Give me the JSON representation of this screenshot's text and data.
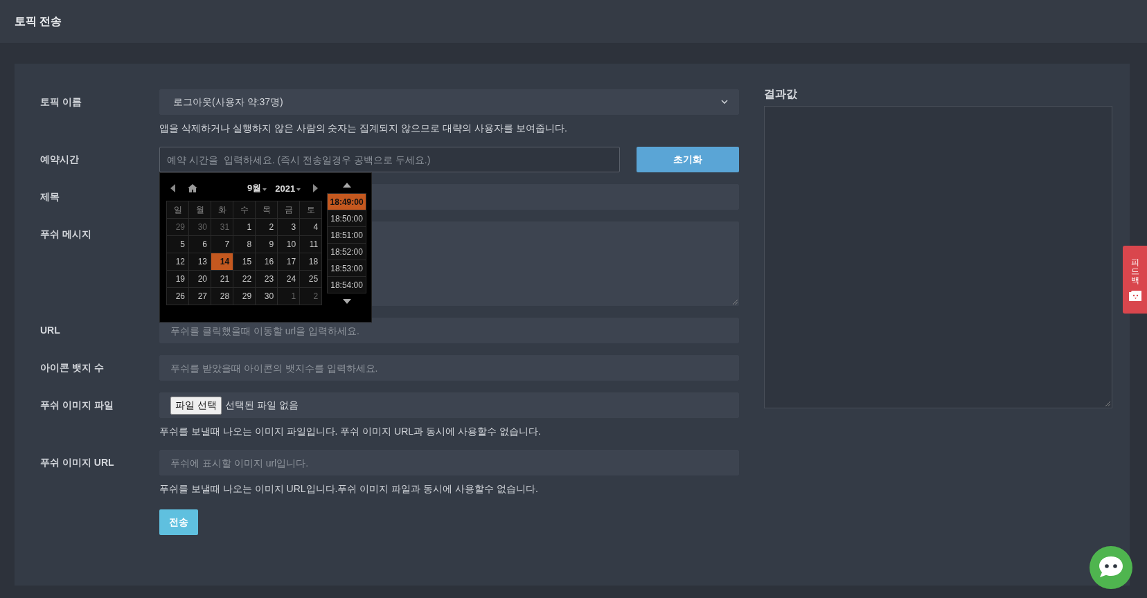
{
  "page_title": "토픽 전송",
  "fields": [
    {
      "kind": "select",
      "label": "토픽 이름",
      "value": "로그아웃(사용자 약:37명)",
      "help": "앱을 삭제하거나 실행하지 않은 사람의 숫자는 집계되지 않으므로 대략의 사용자를 보여줍니다."
    },
    {
      "kind": "datetime",
      "label": "예약시간",
      "placeholder": "예약 시간을  입력하세요. (즉시 전송일경우 공백으로 두세요.)",
      "button": "초기화"
    },
    {
      "kind": "text",
      "label": "제목"
    },
    {
      "kind": "textarea",
      "label": "푸쉬 메시지"
    },
    {
      "kind": "text",
      "label": "URL",
      "placeholder": "푸쉬를 클릭했을때 이동할 url을 입력하세요."
    },
    {
      "kind": "text",
      "label": "아이콘 뱃지 수",
      "placeholder": "푸쉬를 받았을때 아이콘의 뱃지수를 입력하세요."
    },
    {
      "kind": "file",
      "label": "푸쉬 이미지 파일",
      "button": "파일 선택",
      "value": "선택된 파일 없음",
      "help": "푸쉬를 보낼때 나오는 이미지 파일입니다. 푸쉬 이미지 URL과 동시에 사용할수 없습니다."
    },
    {
      "kind": "text",
      "label": "푸쉬 이미지 URL",
      "placeholder": "푸쉬에 표시할 이미지 url입니다.",
      "help": "푸쉬를 보낼때 나오는 이미지 URL입니다.푸쉬 이미지 파일과 동시에 사용할수 없습니다."
    }
  ],
  "submit": "전송",
  "result": {
    "title": "결과값"
  },
  "datepicker": {
    "month": "9월",
    "year": "2021",
    "weekdays": [
      "일",
      "월",
      "화",
      "수",
      "목",
      "금",
      "토"
    ],
    "weeks": [
      [
        {
          "day": "29",
          "muted": true,
          "selected": false
        },
        {
          "day": "30",
          "muted": true,
          "selected": false
        },
        {
          "day": "31",
          "muted": true,
          "selected": false
        },
        {
          "day": "1",
          "muted": false,
          "selected": false
        },
        {
          "day": "2",
          "muted": false,
          "selected": false
        },
        {
          "day": "3",
          "muted": false,
          "selected": false
        },
        {
          "day": "4",
          "muted": false,
          "selected": false
        }
      ],
      [
        {
          "day": "5",
          "muted": false,
          "selected": false
        },
        {
          "day": "6",
          "muted": false,
          "selected": false
        },
        {
          "day": "7",
          "muted": false,
          "selected": false
        },
        {
          "day": "8",
          "muted": false,
          "selected": false
        },
        {
          "day": "9",
          "muted": false,
          "selected": false
        },
        {
          "day": "10",
          "muted": false,
          "selected": false
        },
        {
          "day": "11",
          "muted": false,
          "selected": false
        }
      ],
      [
        {
          "day": "12",
          "muted": false,
          "selected": false
        },
        {
          "day": "13",
          "muted": false,
          "selected": false
        },
        {
          "day": "14",
          "muted": false,
          "selected": true
        },
        {
          "day": "15",
          "muted": false,
          "selected": false
        },
        {
          "day": "16",
          "muted": false,
          "selected": false
        },
        {
          "day": "17",
          "muted": false,
          "selected": false
        },
        {
          "day": "18",
          "muted": false,
          "selected": false
        }
      ],
      [
        {
          "day": "19",
          "muted": false,
          "selected": false
        },
        {
          "day": "20",
          "muted": false,
          "selected": false
        },
        {
          "day": "21",
          "muted": false,
          "selected": false
        },
        {
          "day": "22",
          "muted": false,
          "selected": false
        },
        {
          "day": "23",
          "muted": false,
          "selected": false
        },
        {
          "day": "24",
          "muted": false,
          "selected": false
        },
        {
          "day": "25",
          "muted": false,
          "selected": false
        }
      ],
      [
        {
          "day": "26",
          "muted": false,
          "selected": false
        },
        {
          "day": "27",
          "muted": false,
          "selected": false
        },
        {
          "day": "28",
          "muted": false,
          "selected": false
        },
        {
          "day": "29",
          "muted": false,
          "selected": false
        },
        {
          "day": "30",
          "muted": false,
          "selected": false
        },
        {
          "day": "1",
          "muted": true,
          "selected": false
        },
        {
          "day": "2",
          "muted": true,
          "selected": false
        }
      ]
    ],
    "times": [
      {
        "label": "18:49:00",
        "selected": true
      },
      {
        "label": "18:50:00",
        "selected": false
      },
      {
        "label": "18:51:00",
        "selected": false
      },
      {
        "label": "18:52:00",
        "selected": false
      },
      {
        "label": "18:53:00",
        "selected": false
      },
      {
        "label": "18:54:00",
        "selected": false
      }
    ]
  },
  "feedback_tab": {
    "label": "피드백"
  }
}
